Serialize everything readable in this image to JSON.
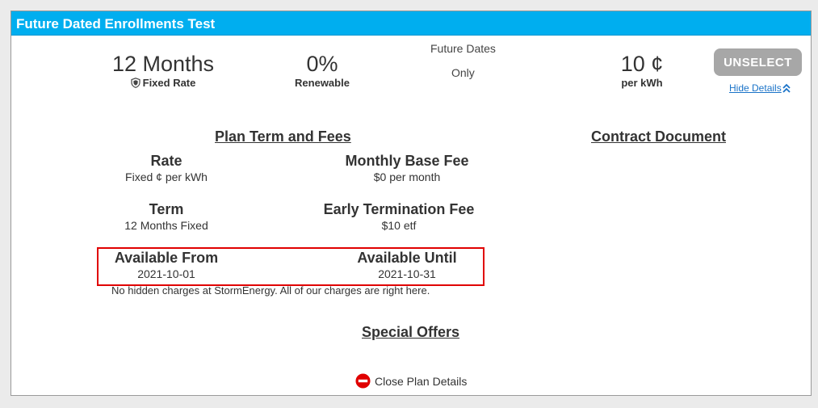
{
  "plan": {
    "title": "Future Dated Enrollments Test",
    "term": {
      "main": "12 Months",
      "sub": "Fixed Rate"
    },
    "renewable": {
      "main": "0%",
      "sub": "Renewable"
    },
    "future_dates": {
      "line1": "Future Dates",
      "line2": "Only"
    },
    "price": {
      "main": "10 ¢",
      "sub": "per kWh"
    },
    "unselect_label": "UNSELECT",
    "hide_details_label": "Hide Details"
  },
  "details": {
    "plan_term_title": "Plan Term and Fees",
    "contract_title": "Contract Document",
    "rate": {
      "label": "Rate",
      "value": "Fixed ¢ per kWh"
    },
    "monthly_fee": {
      "label": "Monthly Base Fee",
      "value": "$0 per month"
    },
    "term": {
      "label": "Term",
      "value": "12 Months Fixed"
    },
    "etf": {
      "label": "Early Termination Fee",
      "value": "$10 etf"
    },
    "available_from": {
      "label": "Available From",
      "value": "2021-10-01"
    },
    "available_until": {
      "label": "Available Until",
      "value": "2021-10-31"
    },
    "note": "No hidden charges at StormEnergy. All of our charges are right here.",
    "special_offers_title": "Special Offers",
    "close_label": "Close Plan Details"
  },
  "colors": {
    "header": "#00aeef",
    "unselect_button": "#a7a7a7",
    "link": "#1a73c8",
    "highlight": "#e00000",
    "close_icon": "#e00000"
  },
  "icons": {
    "term": "shield-icon",
    "hide_details": "double-chevron-up-icon",
    "close": "minus-circle-icon"
  }
}
